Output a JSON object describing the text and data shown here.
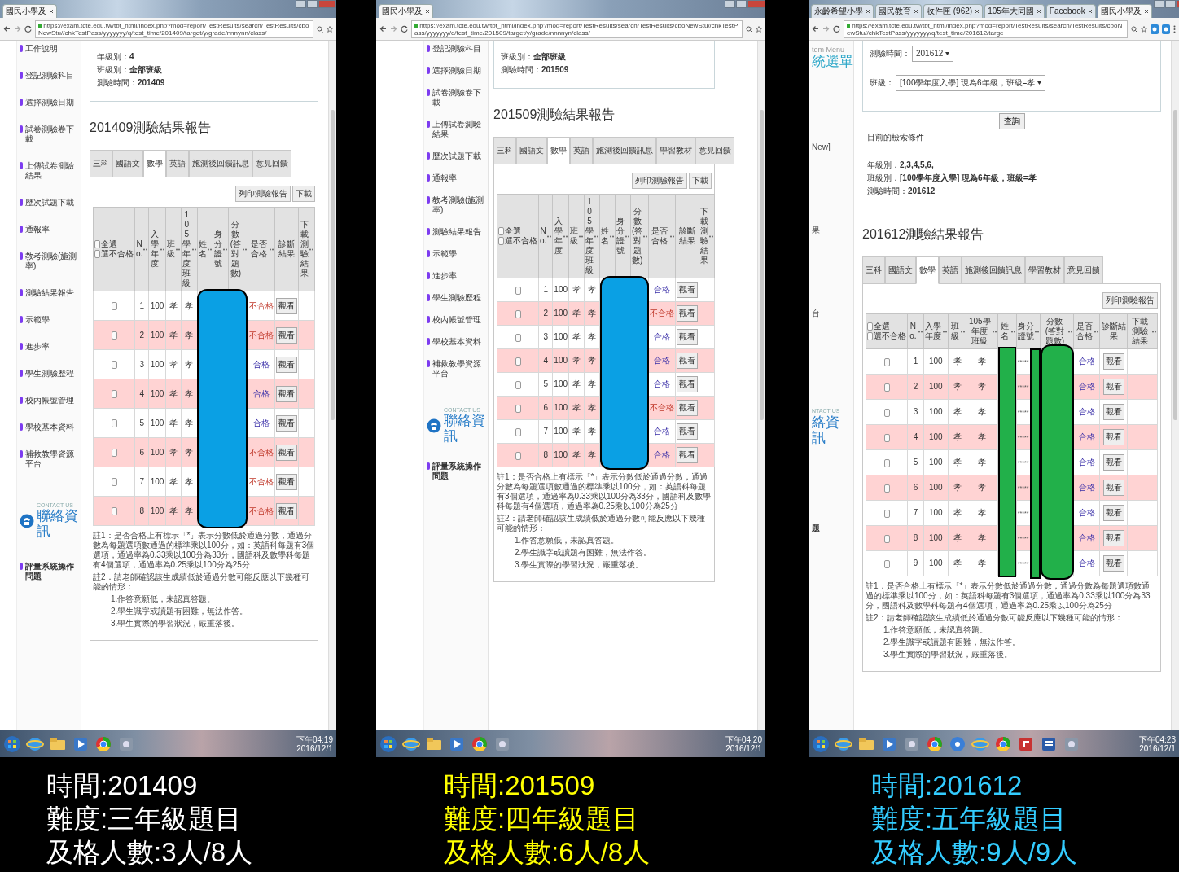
{
  "panels": [
    {
      "browser_tabs": [
        {
          "label": "國民小學及",
          "selected": true
        }
      ],
      "url": "https://exam.tcte.edu.tw/tbt_html/index.php?mod=report/TestResults/search/TestResults/cboNewStu//chkTestPass/yyyyyyy/q/test_time/201409/target/y/grade/nnnynn/class/",
      "address_icons": [
        {
          "kind": "zoom"
        },
        {
          "kind": "star"
        }
      ],
      "sidebar": {
        "items": [
          {
            "kind": "link",
            "label": "工作說明"
          },
          {
            "kind": "link",
            "label": "登記測驗科目"
          },
          {
            "kind": "link",
            "label": "選擇測驗日期"
          },
          {
            "kind": "link",
            "label": "試卷測驗卷下載"
          },
          {
            "kind": "link",
            "label": "上傳試卷測驗結果"
          },
          {
            "kind": "link",
            "label": "歷次試題下載"
          },
          {
            "kind": "link",
            "label": "通報率"
          },
          {
            "kind": "link",
            "label": "教考測驗(施測率)"
          },
          {
            "kind": "link",
            "label": "測驗結果報告"
          },
          {
            "kind": "link",
            "label": "示範學"
          },
          {
            "kind": "link",
            "label": "進步率"
          },
          {
            "kind": "link",
            "label": "學生測驗歷程"
          },
          {
            "kind": "link",
            "label": "校內帳號管理"
          },
          {
            "kind": "link",
            "label": "學校基本資料"
          },
          {
            "kind": "link",
            "label": "補救教學資源平台"
          }
        ],
        "contact": {
          "en": "CONTACT US",
          "title": "聯絡資訊"
        },
        "section": "評量系統操作問題"
      },
      "criteria": [
        "年級別：**4**",
        "班級別：**全部班級**",
        "測驗時間：**201409**"
      ],
      "report_title": "201409測驗結果報告",
      "tabs": [
        {
          "label": "三科",
          "selected": false
        },
        {
          "label": "國語文",
          "selected": false
        },
        {
          "label": "數學",
          "selected": true
        },
        {
          "label": "英語",
          "selected": false
        },
        {
          "label": "施測後回饋訊息",
          "selected": false
        },
        {
          "label": "意見回饋",
          "selected": false
        }
      ],
      "actions": [
        "列印測驗報告",
        "下載"
      ],
      "table": {
        "select_all": {
          "label": "全選",
          "checked": false
        },
        "select_failed": {
          "label": "選不合格",
          "checked": false
        },
        "columns": [
          "No.",
          "入學年度",
          "班級",
          "105學年度班級",
          "姓名",
          "身分證號",
          "分數(答對題數)",
          "是否合格",
          "診斷結果",
          "下載測驗結果"
        ],
        "rows": [
          {
            "checked": false,
            "no": "1",
            "year": "100",
            "class": "孝",
            "class_105": "孝",
            "result": "不合格",
            "pass": false,
            "action": "觀看"
          },
          {
            "checked": false,
            "no": "2",
            "year": "100",
            "class": "孝",
            "class_105": "孝",
            "result": "不合格",
            "pass": false,
            "action": "觀看"
          },
          {
            "checked": false,
            "no": "3",
            "year": "100",
            "class": "孝",
            "class_105": "孝",
            "result": "合格",
            "pass": true,
            "action": "觀看"
          },
          {
            "checked": false,
            "no": "4",
            "year": "100",
            "class": "孝",
            "class_105": "孝",
            "result": "合格",
            "pass": true,
            "action": "觀看"
          },
          {
            "checked": false,
            "no": "5",
            "year": "100",
            "class": "孝",
            "class_105": "孝",
            "result": "合格",
            "pass": true,
            "action": "觀看"
          },
          {
            "checked": false,
            "no": "6",
            "year": "100",
            "class": "孝",
            "class_105": "孝",
            "result": "不合格",
            "pass": false,
            "action": "觀看"
          },
          {
            "checked": false,
            "no": "7",
            "year": "100",
            "class": "孝",
            "class_105": "孝",
            "result": "不合格",
            "pass": false,
            "action": "觀看"
          },
          {
            "checked": false,
            "no": "8",
            "year": "100",
            "class": "孝",
            "class_105": "孝",
            "result": "不合格",
            "pass": false,
            "action": "觀看"
          }
        ]
      },
      "redaction": {
        "kind": "block"
      },
      "notes": [
        {
          "text": "註1：是否合格上有標示「*」表示分數低於通過分數，通過分數為每題選項數通過的標準乘以100分，如：英語科每題有3個選項，通過率為0.33乘以100分為33分，國語科及數學科每題有4個選項，通過率為0.25乘以100分為25分"
        },
        {
          "text": "註2：請老師確認該生成績低於通過分數可能反應以下幾種可能的情形：",
          "items": [
            "1.作答意願低，未認真答題。",
            "2.學生識字或讀題有困難，無法作答。",
            "3.學生實際的學習狀況，嚴重落後。"
          ]
        }
      ],
      "taskbar": {
        "icons": [
          {
            "kind": "start"
          },
          {
            "kind": "globe"
          },
          {
            "kind": "folder"
          },
          {
            "kind": "media"
          },
          {
            "kind": "wheel"
          },
          {
            "kind": "app"
          }
        ],
        "clock": [
          "下午04:19",
          "2016/12/1"
        ]
      }
    },
    {
      "browser_tabs": [
        {
          "label": "國民小學及",
          "selected": true
        }
      ],
      "url": "https://exam.tcte.edu.tw/tbt_html/index.php?mod=report/TestResults/search/TestResults/cboNewStu//chkTestPass/yyyyyyy/q/test_time/201509/target/y/grade/nnnnyn/class/",
      "address_icons": [
        {
          "kind": "zoom"
        },
        {
          "kind": "star"
        }
      ],
      "sidebar": {
        "items": [
          {
            "kind": "link",
            "label": "登記測驗科目"
          },
          {
            "kind": "link",
            "label": "選擇測驗日期"
          },
          {
            "kind": "link",
            "label": "試卷測驗卷下載"
          },
          {
            "kind": "link",
            "label": "上傳試卷測驗結果"
          },
          {
            "kind": "link",
            "label": "歷次試題下載"
          },
          {
            "kind": "link",
            "label": "通報率"
          },
          {
            "kind": "link",
            "label": "教考測驗(施測率)"
          },
          {
            "kind": "link",
            "label": "測驗結果報告"
          },
          {
            "kind": "link",
            "label": "示範學"
          },
          {
            "kind": "link",
            "label": "進步率"
          },
          {
            "kind": "link",
            "label": "學生測驗歷程"
          },
          {
            "kind": "link",
            "label": "校內帳號管理"
          },
          {
            "kind": "link",
            "label": "學校基本資料"
          },
          {
            "kind": "link",
            "label": "補救教學資源平台"
          }
        ],
        "contact": {
          "en": "CONTACT US",
          "title": "聯絡資訊"
        },
        "section": "評量系統操作問題"
      },
      "criteria": [
        "班級別：**全部班級**",
        "測驗時間：**201509**"
      ],
      "report_title": "201509測驗結果報告",
      "tabs": [
        {
          "label": "三科",
          "selected": false
        },
        {
          "label": "國語文",
          "selected": false
        },
        {
          "label": "數學",
          "selected": true
        },
        {
          "label": "英語",
          "selected": false
        },
        {
          "label": "施測後回饋訊息",
          "selected": false
        },
        {
          "label": "學習教材",
          "selected": false
        },
        {
          "label": "意見回饋",
          "selected": false
        }
      ],
      "actions": [
        "列印測驗報告",
        "下載"
      ],
      "table": {
        "select_all": {
          "label": "全選",
          "checked": false
        },
        "select_failed": {
          "label": "選不合格",
          "checked": false
        },
        "columns": [
          "No.",
          "入學年度",
          "班級",
          "105學年度班級",
          "姓名",
          "身分證號",
          "分數(答對題數)",
          "是否合格",
          "診斷結果",
          "下載測驗結果"
        ],
        "rows": [
          {
            "checked": false,
            "no": "1",
            "year": "100",
            "class": "孝",
            "class_105": "孝",
            "result": "合格",
            "pass": true,
            "action": "觀看"
          },
          {
            "checked": false,
            "no": "2",
            "year": "100",
            "class": "孝",
            "class_105": "孝",
            "result": "不合格",
            "pass": false,
            "action": "觀看"
          },
          {
            "checked": false,
            "no": "3",
            "year": "100",
            "class": "孝",
            "class_105": "孝",
            "result": "合格",
            "pass": true,
            "action": "觀看"
          },
          {
            "checked": false,
            "no": "4",
            "year": "100",
            "class": "孝",
            "class_105": "孝",
            "result": "合格",
            "pass": true,
            "action": "觀看"
          },
          {
            "checked": false,
            "no": "5",
            "year": "100",
            "class": "孝",
            "class_105": "孝",
            "result": "合格",
            "pass": true,
            "action": "觀看"
          },
          {
            "checked": false,
            "no": "6",
            "year": "100",
            "class": "孝",
            "class_105": "孝",
            "result": "不合格",
            "pass": false,
            "action": "觀看"
          },
          {
            "checked": false,
            "no": "7",
            "year": "100",
            "class": "孝",
            "class_105": "孝",
            "result": "合格",
            "pass": true,
            "action": "觀看"
          },
          {
            "checked": false,
            "no": "8",
            "year": "100",
            "class": "孝",
            "class_105": "孝",
            "result": "合格",
            "pass": true,
            "action": "觀看"
          }
        ]
      },
      "redaction": {
        "kind": "block"
      },
      "notes": [
        {
          "text": "註1：是否合格上有標示「*」表示分數低於通過分數，通過分數為每題選項數通過的標準乘以100分，如：英語科每題有3個選項，通過率為0.33乘以100分為33分，國語科及數學科每題有4個選項，通過率為0.25乘以100分為25分"
        },
        {
          "text": "註2：請老師確認該生成績低於通過分數可能反應以下幾種可能的情形：",
          "items": [
            "1.作答意願低，未認真答題。",
            "2.學生識字或讀題有困難，無法作答。",
            "3.學生實際的學習狀況，嚴重落後。"
          ]
        }
      ],
      "taskbar": {
        "icons": [
          {
            "kind": "start"
          },
          {
            "kind": "globe"
          },
          {
            "kind": "folder"
          },
          {
            "kind": "media"
          },
          {
            "kind": "wheel"
          },
          {
            "kind": "app"
          }
        ],
        "clock": [
          "下午04:20",
          "2016/12/1"
        ]
      }
    },
    {
      "browser_tabs": [
        {
          "label": "永齡希望小學",
          "selected": false
        },
        {
          "label": "國民教育",
          "selected": false
        },
        {
          "label": "收件匣 (962)",
          "selected": false
        },
        {
          "label": "105年大同國",
          "selected": false
        },
        {
          "label": "Facebook",
          "selected": false
        },
        {
          "label": "國民小學及",
          "selected": true
        }
      ],
      "url": "https://exam.tcte.edu.tw/tbt_html/index.php?mod=report/TestResults/search/TestResults/cboNewStu//chkTestPass/yyyyyyy/q/test_time/201612/targe",
      "address_icons": [
        {
          "kind": "zoom"
        },
        {
          "kind": "star"
        },
        {
          "kind": "ext"
        },
        {
          "kind": "ext"
        },
        {
          "kind": "menu"
        }
      ],
      "sidebar": {
        "menu_en": "tem Menu",
        "menu_title": "統選單",
        "items": [
          {
            "kind": "fragment",
            "label": "New]"
          },
          {
            "kind": "fragment",
            "label": "果"
          },
          {
            "kind": "fragment",
            "label": "台"
          }
        ],
        "contact": {
          "en": "NTACT US",
          "title": "絡資訊"
        },
        "section": "題"
      },
      "query": {
        "time_label": "測驗時間：",
        "time_value": "201612",
        "class_label": "班級：",
        "class_value": "[100學年度入學] 現為6年級，班級=孝",
        "button": "查詢"
      },
      "criteria_title": "目前的檢索條件",
      "criteria": [
        "年級別：**2,3,4,5,6,**",
        "班級別：**[100學年度入學] 現為6年級，班級=孝**",
        "測驗時間：**201612**"
      ],
      "report_title": "201612測驗結果報告",
      "tabs": [
        {
          "label": "三科",
          "selected": false
        },
        {
          "label": "國語文",
          "selected": false
        },
        {
          "label": "數學",
          "selected": true
        },
        {
          "label": "英語",
          "selected": false
        },
        {
          "label": "施測後回饋訊息",
          "selected": false
        },
        {
          "label": "學習教材",
          "selected": false
        },
        {
          "label": "意見回饋",
          "selected": false
        }
      ],
      "actions": [
        "列印測驗報告"
      ],
      "table": {
        "select_all": {
          "label": "全選",
          "checked": false
        },
        "select_failed": {
          "label": "選不合格",
          "checked": false
        },
        "columns": [
          "No.",
          "入學年度",
          "班級",
          "105學年度班級",
          "姓名",
          "身分證號",
          "分數(答對題數)",
          "是否合格",
          "診斷結果",
          "下載測驗結果"
        ],
        "rows": [
          {
            "checked": false,
            "no": "1",
            "year": "100",
            "class": "孝",
            "class_105": "孝",
            "id": "*****",
            "result": "合格",
            "pass": true,
            "action": "觀看"
          },
          {
            "checked": false,
            "no": "2",
            "year": "100",
            "class": "孝",
            "class_105": "孝",
            "id": "*****",
            "result": "合格",
            "pass": true,
            "action": "觀看"
          },
          {
            "checked": false,
            "no": "3",
            "year": "100",
            "class": "孝",
            "class_105": "孝",
            "id": "*****",
            "result": "合格",
            "pass": true,
            "action": "觀看"
          },
          {
            "checked": false,
            "no": "4",
            "year": "100",
            "class": "孝",
            "class_105": "孝",
            "id": "*****",
            "result": "合格",
            "pass": true,
            "action": "觀看"
          },
          {
            "checked": false,
            "no": "5",
            "year": "100",
            "class": "孝",
            "class_105": "孝",
            "id": "*****",
            "result": "合格",
            "pass": true,
            "action": "觀看"
          },
          {
            "checked": false,
            "no": "6",
            "year": "100",
            "class": "孝",
            "class_105": "孝",
            "id": "*****",
            "result": "合格",
            "pass": true,
            "action": "觀看"
          },
          {
            "checked": false,
            "no": "7",
            "year": "100",
            "class": "孝",
            "class_105": "孝",
            "id": "*****",
            "result": "合格",
            "pass": true,
            "action": "觀看"
          },
          {
            "checked": false,
            "no": "8",
            "year": "100",
            "class": "孝",
            "class_105": "孝",
            "id": "*****",
            "result": "合格",
            "pass": true,
            "action": "觀看"
          },
          {
            "checked": false,
            "no": "9",
            "year": "100",
            "class": "孝",
            "class_105": "孝",
            "id": "*****",
            "result": "合格",
            "pass": true,
            "action": "觀看"
          }
        ]
      },
      "redaction": {
        "kind": "bars"
      },
      "notes": [
        {
          "text": "註1：是否合格上有標示「*」表示分數低於通過分數，通過分數為每題選項數通過的標準乘以100分，如：英語科每題有3個選項，通過率為0.33乘以100分為33分，國語科及數學科每題有4個選項，通過率為0.25乘以100分為25分"
        },
        {
          "text": "註2：請老師確認該生成績低於通過分數可能反應以下幾種可能的情形：",
          "items": [
            "1.作答意願低，未認真答題。",
            "2.學生識字或讀題有困難，無法作答。",
            "3.學生實際的學習狀況，嚴重落後。"
          ]
        }
      ],
      "taskbar": {
        "icons": [
          {
            "kind": "start"
          },
          {
            "kind": "globe"
          },
          {
            "kind": "folder"
          },
          {
            "kind": "media"
          },
          {
            "kind": "app"
          },
          {
            "kind": "wheel"
          },
          {
            "kind": "disc"
          },
          {
            "kind": "globe"
          },
          {
            "kind": "wheel"
          },
          {
            "kind": "red"
          },
          {
            "kind": "doc"
          },
          {
            "kind": "app"
          }
        ],
        "clock": [
          "下午04:23",
          "2016/12/1"
        ]
      }
    }
  ],
  "captions": [
    {
      "color": "#ffffff",
      "lines": [
        "時間:201409",
        "難度:三年級題目",
        "及格人數:3人/8人"
      ]
    },
    {
      "color": "#ffff00",
      "lines": [
        "時間:201509",
        "難度:四年級題目",
        "及格人數:6人/8人"
      ]
    },
    {
      "color": "#33ccff",
      "lines": [
        "時間:201612",
        "難度:五年級題目",
        "及格人數:9人/9人"
      ]
    }
  ]
}
